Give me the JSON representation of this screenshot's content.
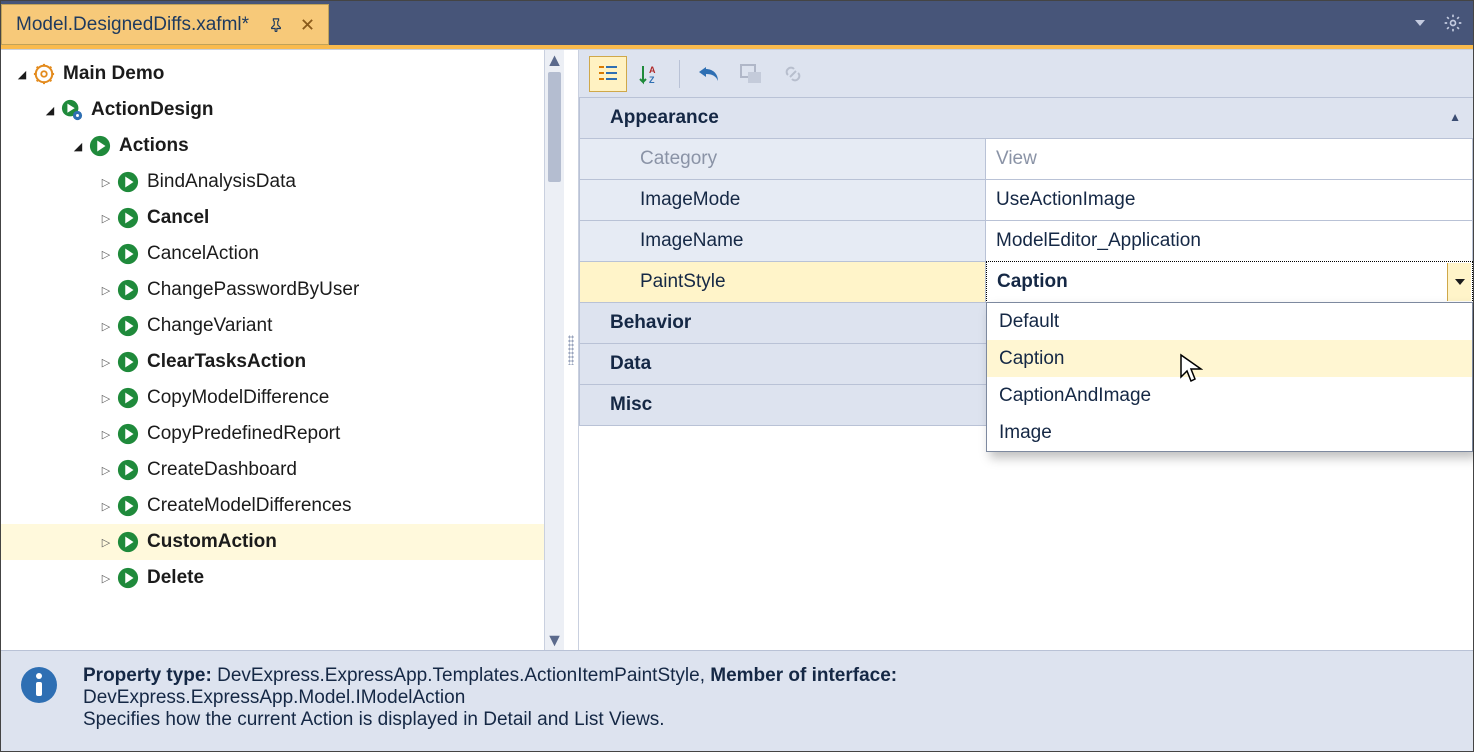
{
  "tab": {
    "title": "Model.DesignedDiffs.xafml*"
  },
  "tree": {
    "root": "Main Demo",
    "actionDesign": "ActionDesign",
    "actions": "Actions",
    "items": [
      {
        "label": "BindAnalysisData",
        "bold": false
      },
      {
        "label": "Cancel",
        "bold": true
      },
      {
        "label": "CancelAction",
        "bold": false
      },
      {
        "label": "ChangePasswordByUser",
        "bold": false
      },
      {
        "label": "ChangeVariant",
        "bold": false
      },
      {
        "label": "ClearTasksAction",
        "bold": true
      },
      {
        "label": "CopyModelDifference",
        "bold": false
      },
      {
        "label": "CopyPredefinedReport",
        "bold": false
      },
      {
        "label": "CreateDashboard",
        "bold": false
      },
      {
        "label": "CreateModelDifferences",
        "bold": false
      },
      {
        "label": "CustomAction",
        "bold": true,
        "selected": true
      },
      {
        "label": "Delete",
        "bold": true
      }
    ]
  },
  "grid": {
    "cat_appearance": "Appearance",
    "cat_behavior": "Behavior",
    "cat_data": "Data",
    "cat_misc": "Misc",
    "props": {
      "category": {
        "name": "Category",
        "value": "View"
      },
      "imageMode": {
        "name": "ImageMode",
        "value": "UseActionImage"
      },
      "imageName": {
        "name": "ImageName",
        "value": "ModelEditor_Application"
      },
      "paintStyle": {
        "name": "PaintStyle",
        "value": "Caption"
      }
    },
    "dropdown": [
      "Default",
      "Caption",
      "CaptionAndImage",
      "Image"
    ]
  },
  "desc": {
    "l1a": "Property type: ",
    "l1b": "DevExpress.ExpressApp.Templates.ActionItemPaintStyle, ",
    "l1c": "Member of interface:",
    "l2": "DevExpress.ExpressApp.Model.IModelAction",
    "l3": "Specifies how the current Action is displayed in Detail and List Views."
  }
}
